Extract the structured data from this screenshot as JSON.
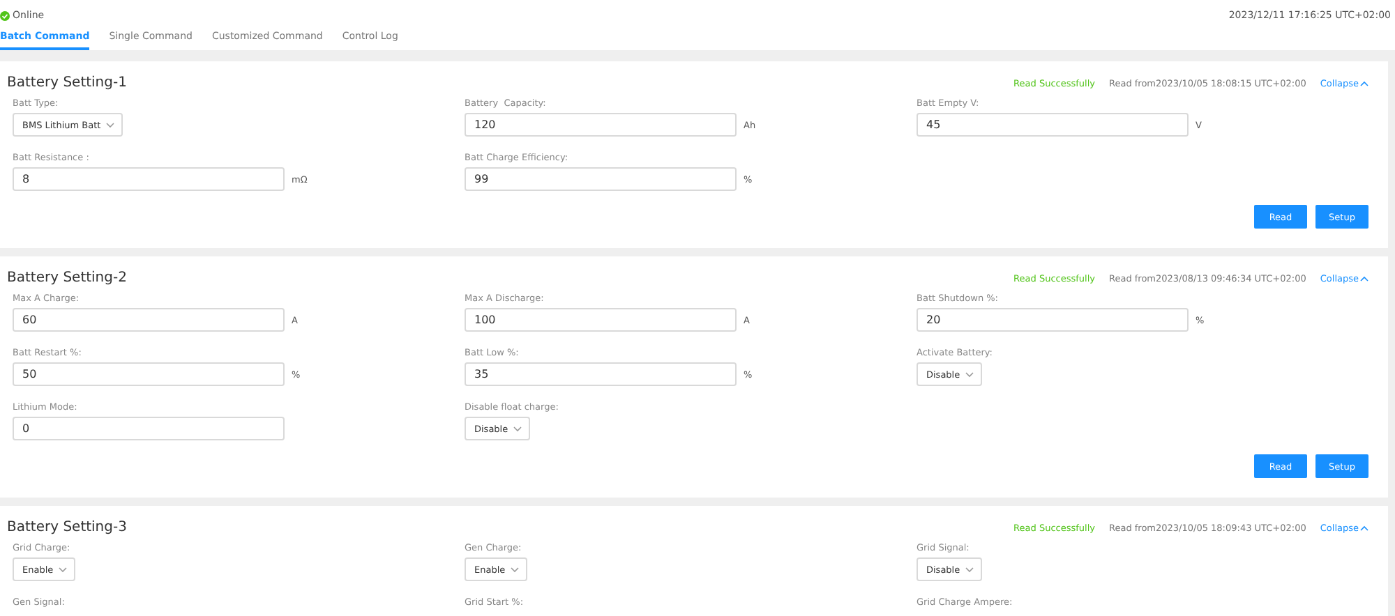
{
  "status": {
    "label": "Online",
    "online": true
  },
  "datetime": "2023/12/11 17:16:25 UTC+02:00",
  "tabs": [
    {
      "label": "Batch Command",
      "selected": true
    },
    {
      "label": "Single Command",
      "selected": false
    },
    {
      "label": "Customized Command",
      "selected": false
    },
    {
      "label": "Control Log",
      "selected": false
    }
  ],
  "sections": [
    {
      "title": "Battery Setting-1",
      "read_status": "Read Successfully",
      "read_from": "Read from2023/10/05 18:08:15 UTC+02:00",
      "collapse": "Collapse",
      "fields": [
        {
          "kind": "select",
          "label": "Batt Type:",
          "value": "BMS Lithium Batt"
        },
        {
          "kind": "input",
          "label": "Battery  Capacity:",
          "value": "120",
          "unit": "Ah"
        },
        {
          "kind": "input",
          "label": "Batt Empty V:",
          "value": "45",
          "unit": "V"
        },
        {
          "kind": "input",
          "label": "Batt Resistance :",
          "value": "8",
          "unit": "mΩ"
        },
        {
          "kind": "input",
          "label": "Batt Charge Efficiency:",
          "value": "99",
          "unit": "%"
        }
      ],
      "buttons": [
        "Read",
        "Setup"
      ]
    },
    {
      "title": "Battery Setting-2",
      "read_status": "Read Successfully",
      "read_from": "Read from2023/08/13 09:46:34 UTC+02:00",
      "collapse": "Collapse",
      "fields": [
        {
          "kind": "input",
          "label": "Max A Charge:",
          "value": "60",
          "unit": "A"
        },
        {
          "kind": "input",
          "label": "Max A Discharge:",
          "value": "100",
          "unit": "A"
        },
        {
          "kind": "input",
          "label": "Batt Shutdown %:",
          "value": "20",
          "unit": "%"
        },
        {
          "kind": "input",
          "label": "Batt Restart %:",
          "value": "50",
          "unit": "%"
        },
        {
          "kind": "input",
          "label": "Batt Low %:",
          "value": "35",
          "unit": "%"
        },
        {
          "kind": "select",
          "label": "Activate Battery:",
          "value": "Disable"
        },
        {
          "kind": "input",
          "label": "Lithium Mode:",
          "value": "0"
        },
        {
          "kind": "select",
          "label": "Disable float charge:",
          "value": "Disable"
        }
      ],
      "buttons": [
        "Read",
        "Setup"
      ]
    },
    {
      "title": "Battery Setting-3",
      "read_status": "Read Successfully",
      "read_from": "Read from2023/10/05 18:09:43 UTC+02:00",
      "collapse": "Collapse",
      "fields": [
        {
          "kind": "select",
          "label": "Grid Charge:",
          "value": "Enable"
        },
        {
          "kind": "select",
          "label": "Gen Charge:",
          "value": "Enable"
        },
        {
          "kind": "select",
          "label": "Grid Signal:",
          "value": "Disable"
        },
        {
          "kind": "label",
          "label": "Gen Signal:"
        },
        {
          "kind": "label",
          "label": "Grid Start %:"
        },
        {
          "kind": "label",
          "label": "Grid Charge Ampere:"
        }
      ]
    }
  ]
}
